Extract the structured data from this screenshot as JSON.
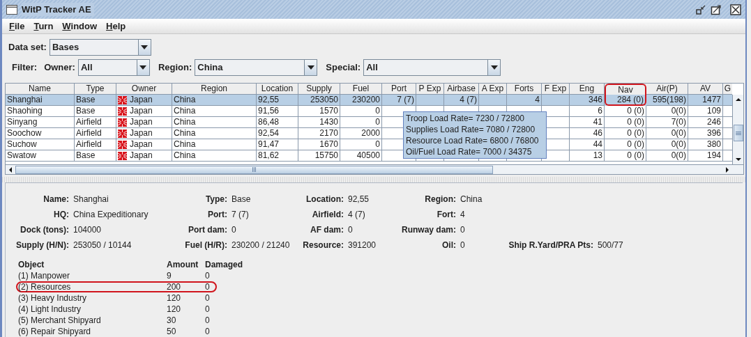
{
  "window": {
    "title": "WitP Tracker AE"
  },
  "menu": [
    "File",
    "Turn",
    "Window",
    "Help"
  ],
  "dataset": {
    "label": "Data set:",
    "value": "Bases"
  },
  "filter": {
    "label": "Filter:",
    "owner": {
      "label": "Owner:",
      "value": "All"
    },
    "region": {
      "label": "Region:",
      "value": "China"
    },
    "special": {
      "label": "Special:",
      "value": "All"
    }
  },
  "table": {
    "columns": [
      {
        "label": "Name",
        "highlighted": false
      },
      {
        "label": "Type",
        "highlighted": false
      },
      {
        "label": "Owner",
        "highlighted": false
      },
      {
        "label": "Region",
        "highlighted": false
      },
      {
        "label": "Location",
        "highlighted": false
      },
      {
        "label": "Supply",
        "highlighted": false
      },
      {
        "label": "Fuel",
        "highlighted": false
      },
      {
        "label": "Port",
        "highlighted": false
      },
      {
        "label": "P Exp",
        "highlighted": false
      },
      {
        "label": "Airbase",
        "highlighted": false
      },
      {
        "label": "A Exp",
        "highlighted": false
      },
      {
        "label": "Forts",
        "highlighted": false
      },
      {
        "label": "F Exp",
        "highlighted": false
      },
      {
        "label": "Eng",
        "highlighted": false
      },
      {
        "label": "Nav",
        "highlighted": true
      },
      {
        "label": "Air(P)",
        "highlighted": false
      },
      {
        "label": "AV",
        "highlighted": false
      },
      {
        "label": "G",
        "highlighted": false
      }
    ],
    "rows": [
      {
        "selected": true,
        "cells": [
          "Shanghai",
          "Base",
          "Japan",
          "China",
          "92,55",
          "253050",
          "230200",
          "7 (7)",
          null,
          "4 (7)",
          null,
          "4",
          null,
          "346",
          "284 (0)",
          "595(198)",
          "1477",
          null
        ]
      },
      {
        "selected": false,
        "cells": [
          "Shaohing",
          "Base",
          "Japan",
          "China",
          "91,56",
          "1570",
          "0",
          null,
          null,
          null,
          null,
          null,
          null,
          "6",
          "0 (0)",
          "0(0)",
          "109",
          null
        ]
      },
      {
        "selected": false,
        "cells": [
          "Sinyang",
          "Airfield",
          "Japan",
          "China",
          "86,48",
          "1430",
          "0",
          null,
          null,
          null,
          null,
          null,
          null,
          "41",
          "0 (0)",
          "7(0)",
          "246",
          null
        ]
      },
      {
        "selected": false,
        "cells": [
          "Soochow",
          "Airfield",
          "Japan",
          "China",
          "92,54",
          "2170",
          "2000",
          null,
          null,
          null,
          null,
          null,
          null,
          "46",
          "0 (0)",
          "0(0)",
          "396",
          null
        ]
      },
      {
        "selected": false,
        "cells": [
          "Suchow",
          "Airfield",
          "Japan",
          "China",
          "91,47",
          "1670",
          "0",
          null,
          null,
          null,
          null,
          null,
          null,
          "44",
          "0 (0)",
          "0(0)",
          "380",
          null
        ]
      },
      {
        "selected": false,
        "cells": [
          "Swatow",
          "Base",
          "Japan",
          "China",
          "81,62",
          "15750",
          "40500",
          null,
          null,
          null,
          null,
          null,
          null,
          "13",
          "0 (0)",
          "0(0)",
          "194",
          null
        ]
      }
    ]
  },
  "tooltip": [
    "Troop Load Rate= 7230 / 72800",
    "Supplies Load Rate= 7080 / 72800",
    "Resource Load Rate= 6800 / 76800",
    "Oil/Fuel Load Rate= 7000 / 34375"
  ],
  "details": [
    [
      {
        "label": "Name:",
        "value": "Shanghai"
      },
      {
        "label": "Type:",
        "value": "Base"
      },
      {
        "label": "Location:",
        "value": "92,55"
      },
      {
        "label": "Region:",
        "value": "China"
      }
    ],
    [
      {
        "label": "HQ:",
        "value": "China Expeditionary"
      },
      {
        "label": "Port:",
        "value": "7 (7)"
      },
      {
        "label": "Airfield:",
        "value": "4 (7)"
      },
      {
        "label": "Fort:",
        "value": "4"
      }
    ],
    [
      {
        "label": "Dock (tons):",
        "value": "104000"
      },
      {
        "label": "Port dam:",
        "value": "0"
      },
      {
        "label": "AF dam:",
        "value": "0"
      },
      {
        "label": "Runway dam:",
        "value": "0"
      }
    ],
    [
      {
        "label": "Supply (H/N):",
        "value": "253050 / 10144"
      },
      {
        "label": "Fuel (H/R):",
        "value": "230200 / 21240"
      },
      {
        "label": "Resource:",
        "value": "391200"
      },
      {
        "label": "Oil:",
        "value": "0"
      },
      {
        "label": "Ship R.Yard/PRA Pts:",
        "value": "500/77"
      }
    ]
  ],
  "objects": {
    "columns": [
      "Object",
      "Amount",
      "Damaged"
    ],
    "rows": [
      {
        "object": "(1) Manpower",
        "amount": "9",
        "damaged": "0",
        "highlighted": false
      },
      {
        "object": "(2) Resources",
        "amount": "200",
        "damaged": "0",
        "highlighted": true
      },
      {
        "object": "(3) Heavy Industry",
        "amount": "120",
        "damaged": "0",
        "highlighted": false
      },
      {
        "object": "(4) Light Industry",
        "amount": "120",
        "damaged": "0",
        "highlighted": false
      },
      {
        "object": "(5) Merchant Shipyard",
        "amount": "30",
        "damaged": "0",
        "highlighted": false
      },
      {
        "object": "(6) Repair Shipyard",
        "amount": "50",
        "damaged": "0",
        "highlighted": false
      }
    ]
  }
}
